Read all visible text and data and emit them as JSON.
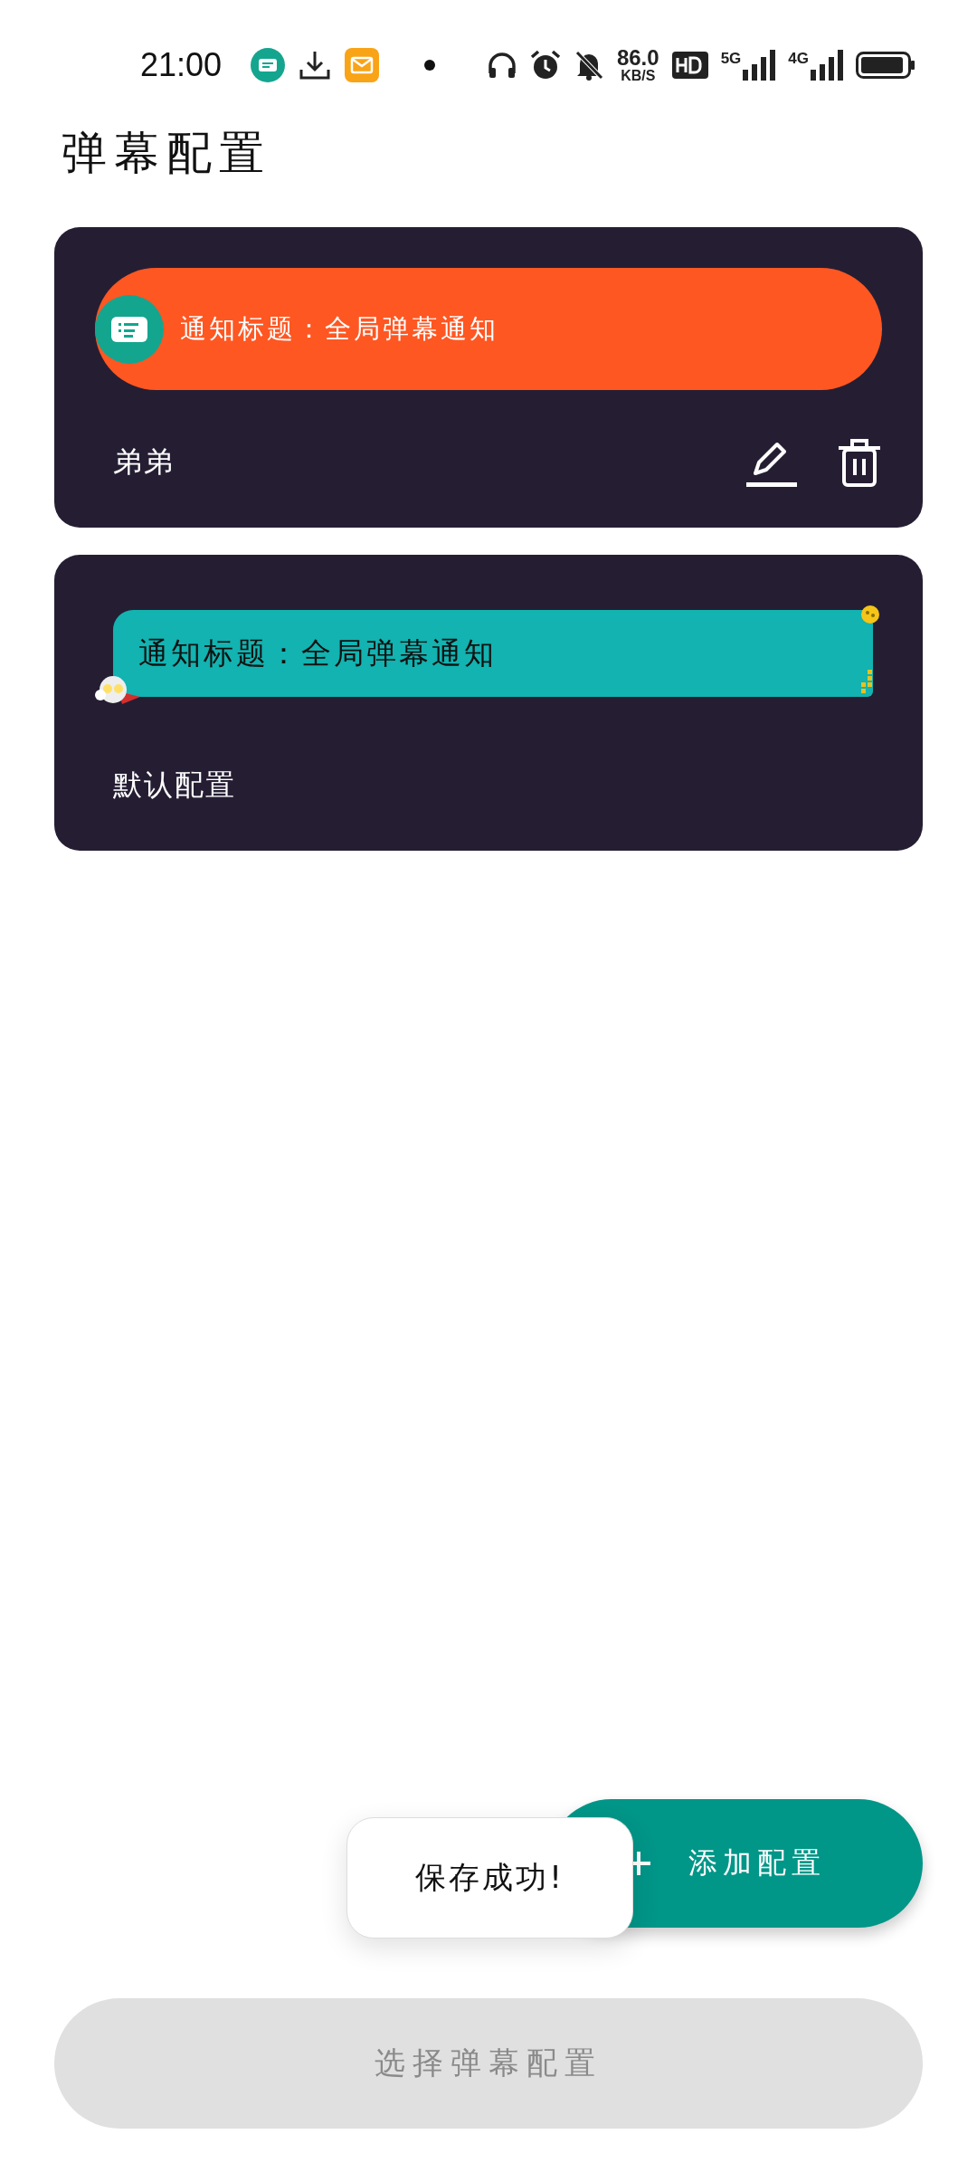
{
  "status_bar": {
    "time": "21:00",
    "net_speed": "86.0",
    "net_unit": "KB/S",
    "signal_1": "5G",
    "signal_2": "4G"
  },
  "title": "弹幕配置",
  "configs": [
    {
      "kind": "pill",
      "preview": "通知标题：全局弹幕通知",
      "name": "弟弟",
      "show_actions": true
    },
    {
      "kind": "bubble",
      "preview": "通知标题：全局弹幕通知",
      "name": "默认配置",
      "show_actions": false
    }
  ],
  "add_button": {
    "label": "添加配置"
  },
  "toast": {
    "text": "保存成功!"
  },
  "select_button": {
    "label": "选择弹幕配置"
  }
}
